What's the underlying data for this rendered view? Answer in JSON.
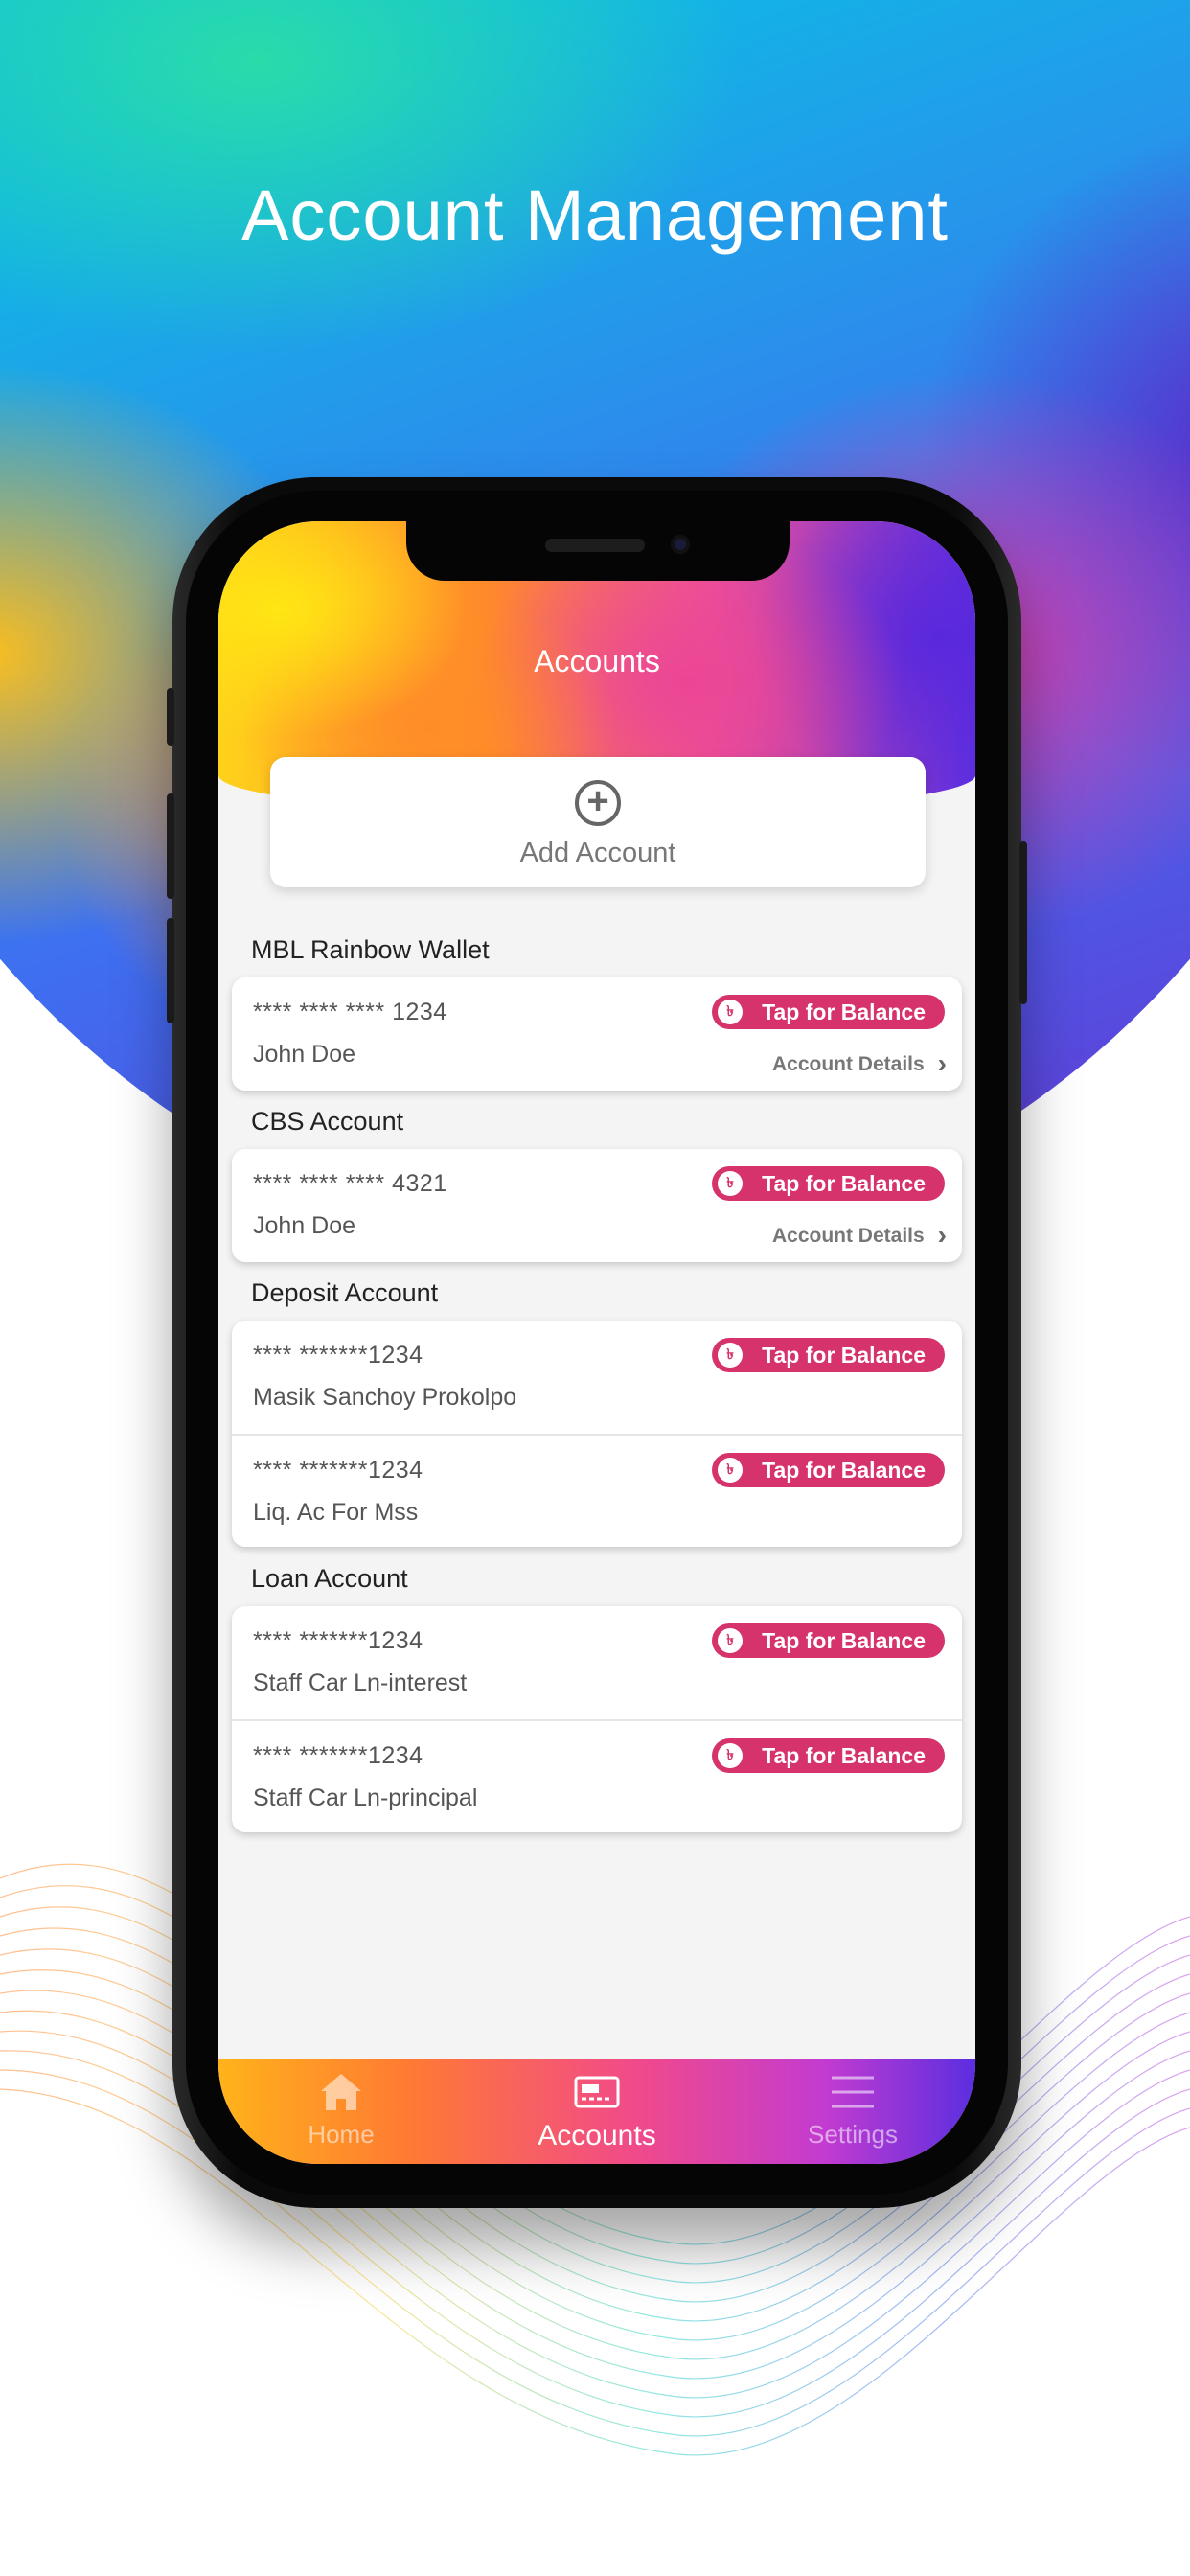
{
  "headline": "Account Management",
  "screen": {
    "title": "Accounts",
    "add_account": "Add Account"
  },
  "sections": [
    {
      "title": "MBL Rainbow Wallet",
      "rows": [
        {
          "number": "**** **** **** 1234",
          "name": "John Doe",
          "balance": "Tap for Balance",
          "details": "Account Details"
        }
      ]
    },
    {
      "title": "CBS Account",
      "rows": [
        {
          "number": "**** **** **** 4321",
          "name": "John Doe",
          "balance": "Tap for Balance",
          "details": "Account Details"
        }
      ]
    },
    {
      "title": "Deposit Account",
      "rows": [
        {
          "number": "**** *******1234",
          "name": "Masik Sanchoy Prokolpo",
          "balance": "Tap for Balance"
        },
        {
          "number": "**** *******1234",
          "name": "Liq. Ac For Mss",
          "balance": "Tap for Balance"
        }
      ]
    },
    {
      "title": "Loan Account",
      "rows": [
        {
          "number": "**** *******1234",
          "name": "Staff Car Ln-interest",
          "balance": "Tap for Balance"
        },
        {
          "number": "**** *******1234",
          "name": "Staff Car Ln-principal",
          "balance": "Tap for Balance"
        }
      ]
    }
  ],
  "tabbar": {
    "home": "Home",
    "accounts": "Accounts",
    "settings": "Settings"
  },
  "icons": {
    "balance_symbol": "৳"
  },
  "colors": {
    "accent": "#d6336c"
  }
}
